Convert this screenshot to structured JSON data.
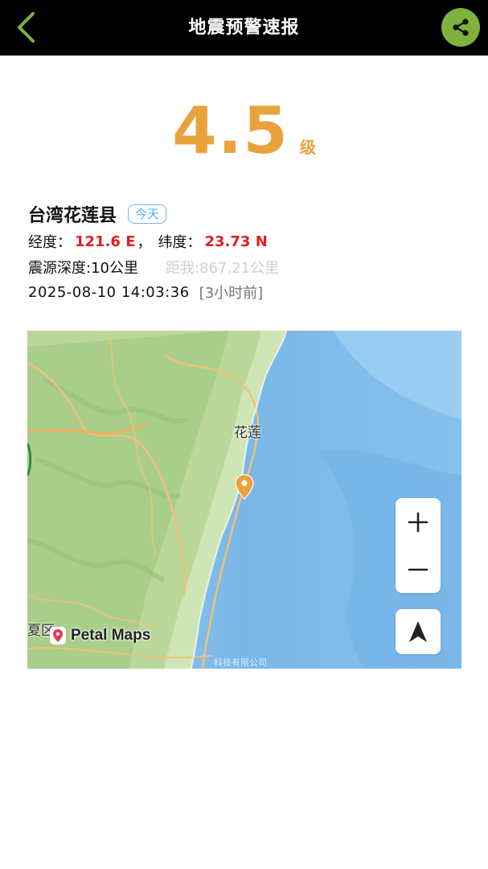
{
  "header": {
    "title": "地震预警速报",
    "back_icon": "chevron-left-icon",
    "share_icon": "share-icon",
    "accent_color": "#7fb23d"
  },
  "quake": {
    "magnitude": "4.5",
    "magnitude_unit": "级",
    "location": "台湾花莲县",
    "badge": "今天",
    "longitude_label": "经度：",
    "longitude_value": "121.6 E",
    "separator": "，",
    "latitude_label": "纬度：",
    "latitude_value": "23.73 N",
    "depth": "震源深度:10公里",
    "distance": "距我:867.21公里",
    "time": "2025-08-10 14:03:36",
    "ago": "[3小时前]"
  },
  "map": {
    "city_label": "花莲",
    "district_label": "夏区",
    "logo_text": "Petal Maps",
    "copyright": "科技有限公司",
    "zoom_in_icon": "plus-icon",
    "zoom_out_icon": "minus-icon",
    "locate_icon": "navigation-arrow-icon",
    "marker_icon": "map-pin-icon"
  },
  "colors": {
    "magnitude": "#e8a33c",
    "coordinate_value": "#e02020",
    "badge": "#5aaee0",
    "distance": "#cfcfcf"
  }
}
